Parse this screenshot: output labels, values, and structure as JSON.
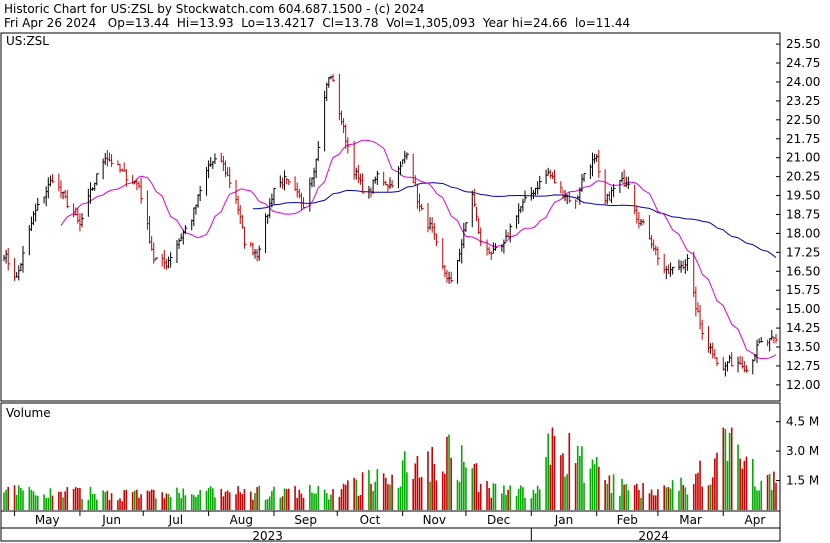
{
  "header": {
    "title_line": "Historic Chart for US:ZSL by Stockwatch.com 604.687.1500 - (c) 2024",
    "quote_line": "Fri Apr 26 2024   Op=13.44  Hi=13.93  Lo=13.4217  Cl=13.78  Vol=1,305,093  Year hi=24.66  lo=11.44"
  },
  "chart_data": [
    {
      "type": "ohlc",
      "panel_label": "US:ZSL",
      "y_ticks": [
        "25.50",
        "24.75",
        "24.00",
        "23.25",
        "22.50",
        "21.75",
        "21.00",
        "20.25",
        "19.50",
        "18.75",
        "18.00",
        "17.25",
        "16.50",
        "15.75",
        "15.00",
        "14.25",
        "13.50",
        "12.75",
        "12.00"
      ],
      "y_range": [
        11.4,
        25.9
      ],
      "x_months": [
        "May",
        "Jun",
        "Jul",
        "Aug",
        "Sep",
        "Oct",
        "Nov",
        "Dec",
        "Jan",
        "Feb",
        "Mar",
        "Apr"
      ],
      "x_years": [
        "2023",
        "2024"
      ],
      "date_range": [
        "2023-04-26",
        "2024-04-26"
      ],
      "price_keypoints": [
        {
          "date": "2023-04-26",
          "close": 17.2
        },
        {
          "date": "2023-05-02",
          "close": 16.2
        },
        {
          "date": "2023-05-10",
          "close": 18.7
        },
        {
          "date": "2023-05-19",
          "close": 20.2
        },
        {
          "date": "2023-05-26",
          "close": 19.2
        },
        {
          "date": "2023-06-01",
          "close": 18.3
        },
        {
          "date": "2023-06-06",
          "close": 19.6
        },
        {
          "date": "2023-06-13",
          "close": 21.1
        },
        {
          "date": "2023-06-21",
          "close": 20.4
        },
        {
          "date": "2023-06-29",
          "close": 19.9
        },
        {
          "date": "2023-07-06",
          "close": 17.0
        },
        {
          "date": "2023-07-12",
          "close": 16.8
        },
        {
          "date": "2023-07-17",
          "close": 17.6
        },
        {
          "date": "2023-07-24",
          "close": 18.6
        },
        {
          "date": "2023-08-01",
          "close": 20.7
        },
        {
          "date": "2023-08-07",
          "close": 20.9
        },
        {
          "date": "2023-08-14",
          "close": 19.4
        },
        {
          "date": "2023-08-18",
          "close": 17.7
        },
        {
          "date": "2023-08-24",
          "close": 17.2
        },
        {
          "date": "2023-09-01",
          "close": 19.8
        },
        {
          "date": "2023-09-06",
          "close": 20.1
        },
        {
          "date": "2023-09-15",
          "close": 19.2
        },
        {
          "date": "2023-09-21",
          "close": 20.9
        },
        {
          "date": "2023-09-26",
          "close": 23.9
        },
        {
          "date": "2023-09-28",
          "close": 24.3
        },
        {
          "date": "2023-10-04",
          "close": 22.1
        },
        {
          "date": "2023-10-09",
          "close": 20.5
        },
        {
          "date": "2023-10-15",
          "close": 19.4
        },
        {
          "date": "2023-10-20",
          "close": 20.3
        },
        {
          "date": "2023-10-26",
          "close": 19.9
        },
        {
          "date": "2023-10-31",
          "close": 20.6
        },
        {
          "date": "2023-11-03",
          "close": 21.3
        },
        {
          "date": "2023-11-09",
          "close": 19.0
        },
        {
          "date": "2023-11-15",
          "close": 18.1
        },
        {
          "date": "2023-11-20",
          "close": 16.6
        },
        {
          "date": "2023-11-24",
          "close": 16.0
        },
        {
          "date": "2023-11-29",
          "close": 17.6
        },
        {
          "date": "2023-12-04",
          "close": 19.6
        },
        {
          "date": "2023-12-08",
          "close": 17.6
        },
        {
          "date": "2023-12-14",
          "close": 17.2
        },
        {
          "date": "2023-12-19",
          "close": 17.5
        },
        {
          "date": "2023-12-24",
          "close": 18.7
        },
        {
          "date": "2024-01-02",
          "close": 19.7
        },
        {
          "date": "2024-01-09",
          "close": 20.4
        },
        {
          "date": "2024-01-16",
          "close": 19.6
        },
        {
          "date": "2024-01-22",
          "close": 19.2
        },
        {
          "date": "2024-01-27",
          "close": 20.7
        },
        {
          "date": "2024-02-01",
          "close": 20.9
        },
        {
          "date": "2024-02-04",
          "close": 19.1
        },
        {
          "date": "2024-02-11",
          "close": 20.0
        },
        {
          "date": "2024-02-16",
          "close": 20.1
        },
        {
          "date": "2024-02-20",
          "close": 18.7
        },
        {
          "date": "2024-02-26",
          "close": 17.9
        },
        {
          "date": "2024-03-01",
          "close": 17.1
        },
        {
          "date": "2024-03-05",
          "close": 16.4
        },
        {
          "date": "2024-03-11",
          "close": 16.7
        },
        {
          "date": "2024-03-15",
          "close": 16.9
        },
        {
          "date": "2024-03-18",
          "close": 15.5
        },
        {
          "date": "2024-03-21",
          "close": 14.4
        },
        {
          "date": "2024-03-24",
          "close": 13.7
        },
        {
          "date": "2024-03-28",
          "close": 13.2
        },
        {
          "date": "2024-03-31",
          "close": 12.4
        },
        {
          "date": "2024-04-03",
          "close": 12.9
        },
        {
          "date": "2024-04-10",
          "close": 12.9
        },
        {
          "date": "2024-04-12",
          "close": 12.6
        },
        {
          "date": "2024-04-18",
          "close": 13.6
        },
        {
          "date": "2024-04-26",
          "close": 13.78
        }
      ],
      "colors": {
        "bar_up": "#000000",
        "bar_down": "#cc0000",
        "ma_short": "#e000e0",
        "ma_long": "#0000aa",
        "axis": "#000000"
      }
    },
    {
      "type": "bar",
      "panel_label": "Volume",
      "y_ticks": [
        "4.5 M",
        "3.0 M",
        "1.5 M"
      ],
      "y_range_millions": [
        0,
        5.4
      ],
      "volume_keypoints_millions": [
        {
          "date": "2023-04-26",
          "v": 0.9
        },
        {
          "date": "2023-07-01",
          "v": 0.8
        },
        {
          "date": "2023-10-01",
          "v": 0.9
        },
        {
          "date": "2023-11-24",
          "v": 3.0
        },
        {
          "date": "2023-12-12",
          "v": 1.0
        },
        {
          "date": "2024-01-05",
          "v": 0.9
        },
        {
          "date": "2024-01-10",
          "v": 3.4
        },
        {
          "date": "2024-02-15",
          "v": 1.0
        },
        {
          "date": "2024-03-15",
          "v": 1.3
        },
        {
          "date": "2024-03-28",
          "v": 2.5
        },
        {
          "date": "2024-04-03",
          "v": 3.9
        },
        {
          "date": "2024-04-12",
          "v": 2.0
        },
        {
          "date": "2024-04-26",
          "v": 1.3
        }
      ],
      "colors": {
        "up": "#00aa00",
        "down": "#cc0000"
      }
    }
  ]
}
